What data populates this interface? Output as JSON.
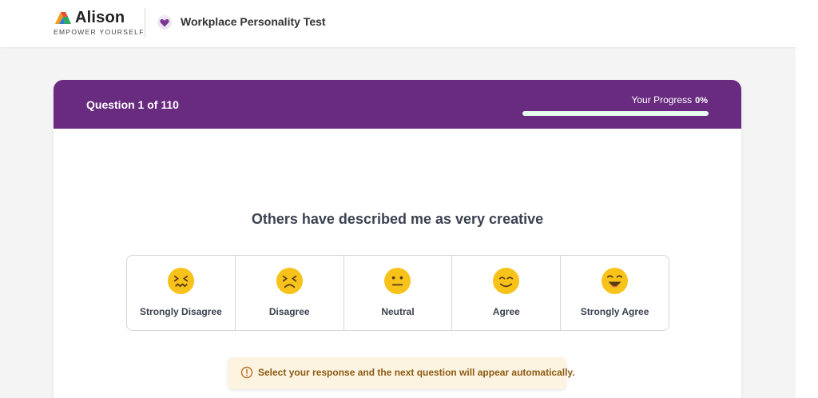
{
  "brand": {
    "name": "Alison",
    "tagline": "EMPOWER YOURSELF",
    "colors": {
      "orange": "#f39c12",
      "green": "#2eaa5c",
      "red": "#e74c3c",
      "blue": "#2f7bd8"
    }
  },
  "header": {
    "title": "Workplace Personality Test",
    "icon": "heart-icon"
  },
  "quiz": {
    "counter": "Question 1 of 110",
    "progress_label": "Your Progress",
    "progress_value": "0%",
    "progress_fraction": 0,
    "question": "Others have described me as very creative",
    "options": [
      {
        "label": "Strongly Disagree",
        "icon": "confounded-face-icon"
      },
      {
        "label": "Disagree",
        "icon": "persevering-face-icon"
      },
      {
        "label": "Neutral",
        "icon": "neutral-face-icon"
      },
      {
        "label": "Agree",
        "icon": "smiling-face-icon"
      },
      {
        "label": "Strongly Agree",
        "icon": "grinning-face-icon"
      }
    ],
    "hint": "Select your response and the next question will appear automatically."
  },
  "theme": {
    "header_purple": "#682b7f",
    "emoji_yellow": "#f7c31a",
    "hint_bg": "#fdf3e1",
    "hint_text": "#8b5a12"
  }
}
